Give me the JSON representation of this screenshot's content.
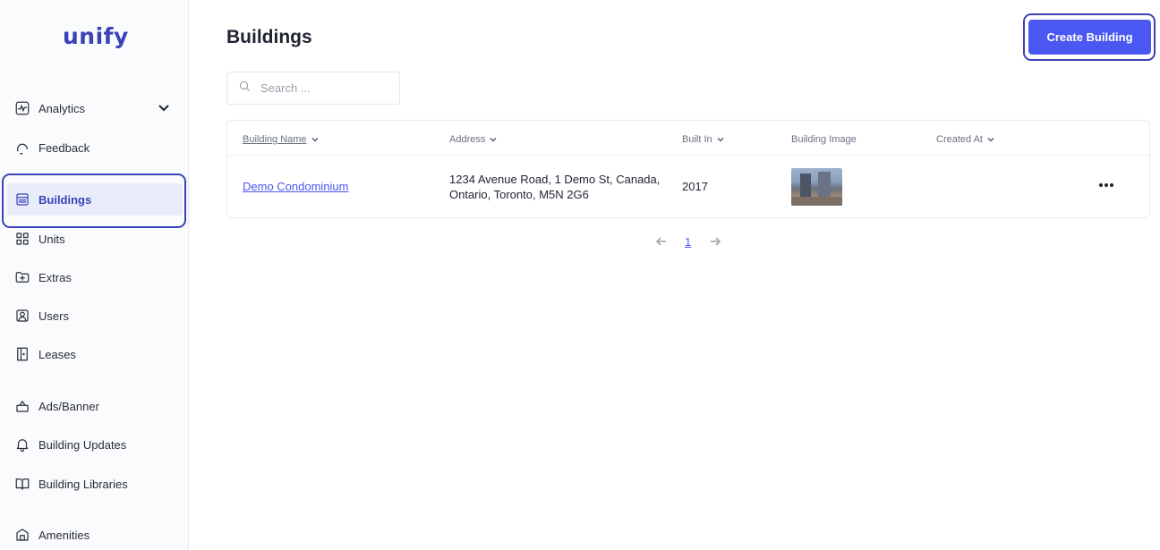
{
  "app": {
    "logo": "unify"
  },
  "sidebar": {
    "items": [
      {
        "label": "Analytics"
      },
      {
        "label": "Feedback"
      },
      {
        "label": "Buildings"
      },
      {
        "label": "Units"
      },
      {
        "label": "Extras"
      },
      {
        "label": "Users"
      },
      {
        "label": "Leases"
      },
      {
        "label": "Ads/Banner"
      },
      {
        "label": "Building Updates"
      },
      {
        "label": "Building Libraries"
      },
      {
        "label": "Amenities"
      }
    ]
  },
  "header": {
    "title": "Buildings",
    "create_label": "Create Building"
  },
  "search": {
    "placeholder": "Search ..."
  },
  "table": {
    "columns": [
      "Building Name",
      "Address",
      "Built In",
      "Building Image",
      "Created At"
    ],
    "rows": [
      {
        "name": "Demo Condominium",
        "address_line1": "1234 Avenue Road, 1 Demo St, Canada,",
        "address_line2": "Ontario, Toronto, M5N 2G6",
        "built_in": "2017",
        "created_at": ""
      }
    ]
  },
  "pagination": {
    "current_page": "1"
  },
  "colors": {
    "accent": "#4a57f0",
    "brand": "#3a43b6",
    "active_bg": "#e9edfb"
  }
}
